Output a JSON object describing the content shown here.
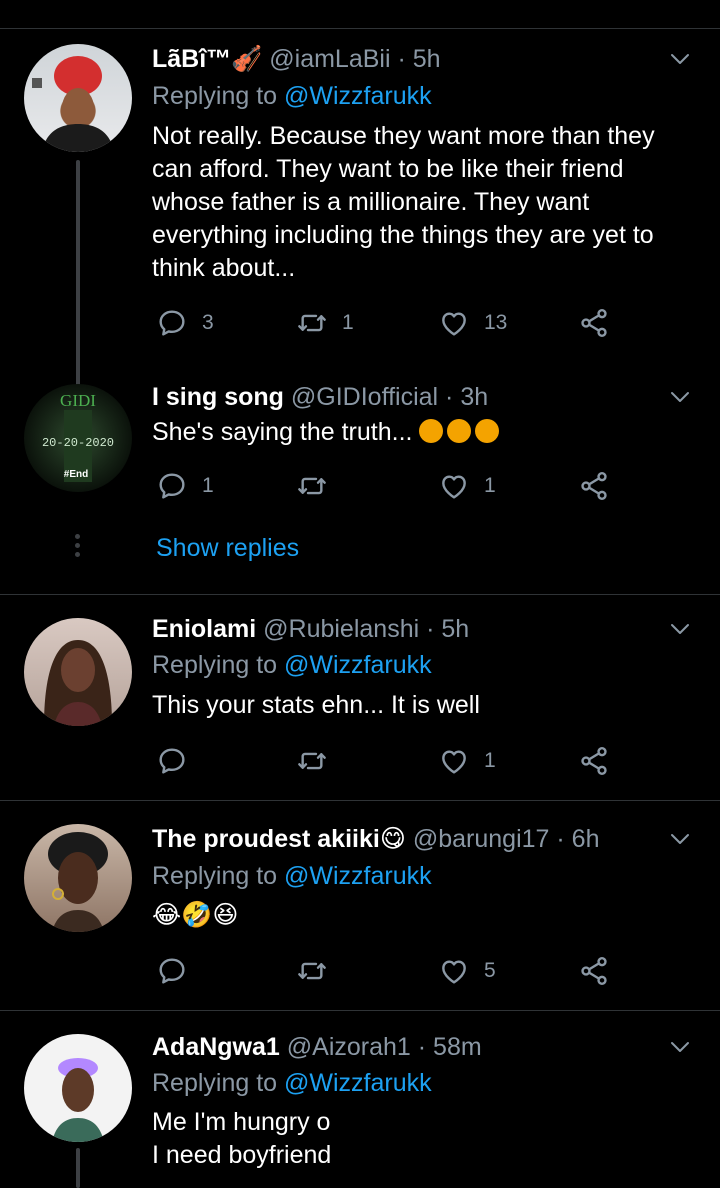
{
  "tweets": [
    {
      "name": "LãBî™🎻",
      "handle": "@iamLaBii",
      "time": "· 5h",
      "reply_prefix": "Replying to",
      "reply_handle": "@Wizzfarukk",
      "text": "Not really. Because they want more than they can afford. They want to be like their friend whose father is a millionaire. They want everything including the things they are yet to think about...",
      "replies": "3",
      "retweets": "1",
      "likes": "13"
    },
    {
      "name": "I sing song",
      "handle": "@GIDIofficial",
      "time": "· 3h",
      "text": "She's saying the truth...",
      "avatar_text_top": "GIDI",
      "avatar_text_mid": "20-20-2020",
      "avatar_text_bottom": "#End",
      "replies": "1",
      "retweets": "",
      "likes": "1",
      "show_replies": "Show replies"
    },
    {
      "name": "Eniolami",
      "handle": "@Rubielanshi",
      "time": "· 5h",
      "reply_prefix": "Replying to",
      "reply_handle": "@Wizzfarukk",
      "text": "This your stats ehn... It is well",
      "replies": "",
      "retweets": "",
      "likes": "1"
    },
    {
      "name": "The proudest akiiki😋",
      "handle": "@barungi17",
      "time": "· 6h",
      "reply_prefix": "Replying to",
      "reply_handle": "@Wizzfarukk",
      "text": "😂🤣😆",
      "replies": "",
      "retweets": "",
      "likes": "5"
    },
    {
      "name": "AdaNgwa1",
      "handle": "@Aizorah1",
      "time": "· 58m",
      "reply_prefix": "Replying to",
      "reply_handle": "@Wizzfarukk",
      "text_line1": "Me I'm hungry o",
      "text_line2": "I need boyfriend"
    }
  ],
  "icons": {
    "reply": "reply-icon",
    "retweet": "retweet-icon",
    "like": "heart-icon",
    "share": "share-icon",
    "caret": "chevron-down-icon"
  },
  "colors": {
    "background": "#000000",
    "muted": "#8b98a5",
    "link": "#1da1f2",
    "divider": "#2f3336"
  }
}
